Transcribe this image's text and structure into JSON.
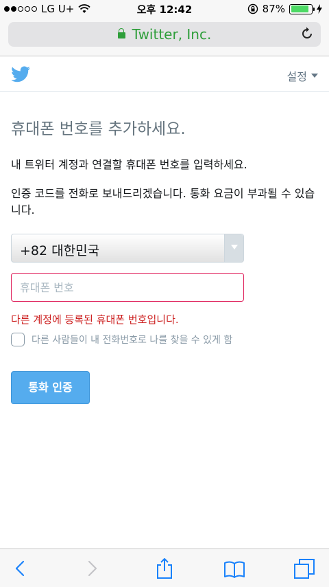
{
  "status_bar": {
    "carrier": "LG U+",
    "time": "오후 12:42",
    "battery_percent": "87%",
    "battery_level": 0.87,
    "signal_bars_filled": 2,
    "signal_bars_total": 5
  },
  "browser": {
    "url_title": "Twitter, Inc.",
    "url_color": "#2e9e3a"
  },
  "header": {
    "settings_label": "설정"
  },
  "page": {
    "title": "휴대폰 번호를 추가하세요.",
    "description_1": "내 트위터 계정과 연결할 휴대폰 번호를 입력하세요.",
    "description_2": "인증 코드를 전화로 보내드리겠습니다. 통화 요금이 부과될 수 있습니다.",
    "country_select_value": "+82 대한민국",
    "phone_placeholder": "휴대폰 번호",
    "phone_value": "",
    "error_message": "다른 계정에 등록된 휴대폰 번호입니다.",
    "discoverable_checkbox_label": "다른 사람들이 내 전화번호로 나를 찾을 수 있게 함",
    "discoverable_checked": false,
    "verify_button_label": "통화 인증"
  },
  "colors": {
    "brand_blue": "#55acee",
    "error_red": "#cc1e1e",
    "secure_green": "#2e9e3a"
  },
  "toolbar": {
    "items": [
      "back-icon",
      "forward-icon",
      "share-icon",
      "bookmarks-icon",
      "tabs-icon"
    ]
  }
}
